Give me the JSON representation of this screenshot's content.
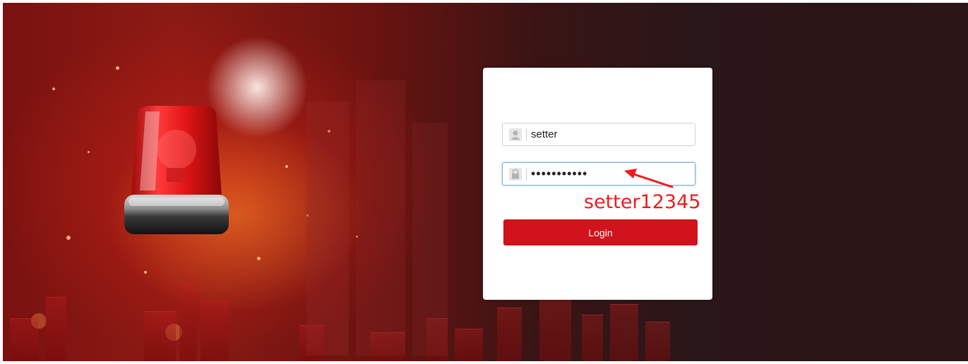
{
  "login": {
    "username_value": "setter",
    "password_value": "•••••••••••",
    "login_label": "Login"
  },
  "annotation": {
    "text": "setter12345",
    "color": "#ef1c1c"
  },
  "icons": {
    "username": "user-icon",
    "password": "lock-icon",
    "beacon": "alarm-beacon-icon"
  },
  "colors": {
    "accent": "#d0131c",
    "focus_border": "#7fb1da"
  }
}
